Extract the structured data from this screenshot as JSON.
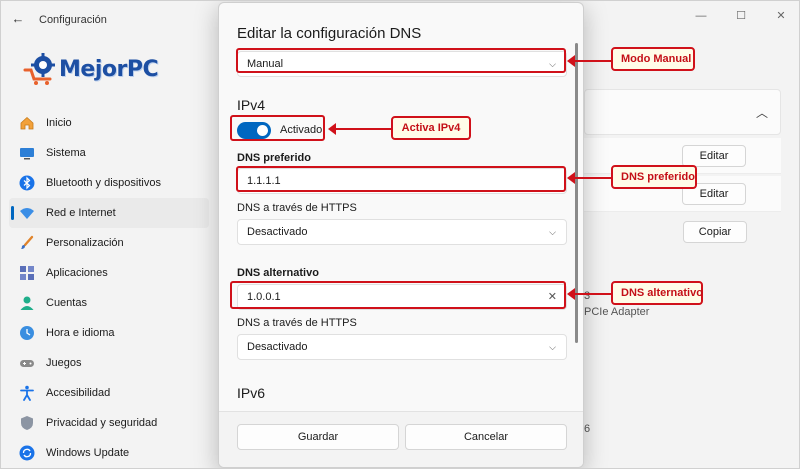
{
  "window": {
    "title": "Configuración",
    "back_glyph": "←",
    "controls": [
      "—",
      "☐",
      "✕"
    ]
  },
  "logo": {
    "text": "MejorPC",
    "colors": {
      "primary": "#1d4fa3",
      "accent": "#e8612c"
    }
  },
  "sidebar": {
    "items": [
      {
        "label": "Inicio",
        "icon": "home-icon",
        "active": false
      },
      {
        "label": "Sistema",
        "icon": "monitor-icon",
        "active": false
      },
      {
        "label": "Bluetooth y dispositivos",
        "icon": "bluetooth-icon",
        "active": false
      },
      {
        "label": "Red e Internet",
        "icon": "wifi-icon",
        "active": true
      },
      {
        "label": "Personalización",
        "icon": "brush-icon",
        "active": false
      },
      {
        "label": "Aplicaciones",
        "icon": "apps-icon",
        "active": false
      },
      {
        "label": "Cuentas",
        "icon": "person-icon",
        "active": false
      },
      {
        "label": "Hora e idioma",
        "icon": "globe-clock-icon",
        "active": false
      },
      {
        "label": "Juegos",
        "icon": "gamepad-icon",
        "active": false
      },
      {
        "label": "Accesibilidad",
        "icon": "accessibility-icon",
        "active": false
      },
      {
        "label": "Privacidad y seguridad",
        "icon": "shield-icon",
        "active": false
      },
      {
        "label": "Windows Update",
        "icon": "update-icon",
        "active": false
      }
    ],
    "accent_color": "#0067c0"
  },
  "background": {
    "buttons": [
      "Editar",
      "Editar",
      "Copiar"
    ],
    "adapter_text": "PCIe Adapter",
    "fragment_3": "3",
    "fragment_6": "6"
  },
  "dialog": {
    "title": "Editar la configuración DNS",
    "mode_select": {
      "value": "Manual"
    },
    "ipv4_heading": "IPv4",
    "ipv4_toggle": {
      "label": "Activado",
      "on": true
    },
    "preferred": {
      "label": "DNS preferido",
      "value": "1.1.1.1"
    },
    "preferred_https": {
      "label": "DNS a través de HTTPS",
      "value": "Desactivado"
    },
    "alternate": {
      "label": "DNS alternativo",
      "value": "1.0.0.1",
      "clear_glyph": "✕"
    },
    "alternate_https": {
      "label": "DNS a través de HTTPS",
      "value": "Desactivado"
    },
    "ipv6_heading": "IPv6",
    "save_label": "Guardar",
    "cancel_label": "Cancelar"
  },
  "annotations": {
    "mode_manual": "Modo Manual",
    "activate_ipv4": "Activa IPv4",
    "dns_preferred": "DNS preferido",
    "dns_alternate": "DNS alternativo",
    "color": "#d0111a"
  }
}
